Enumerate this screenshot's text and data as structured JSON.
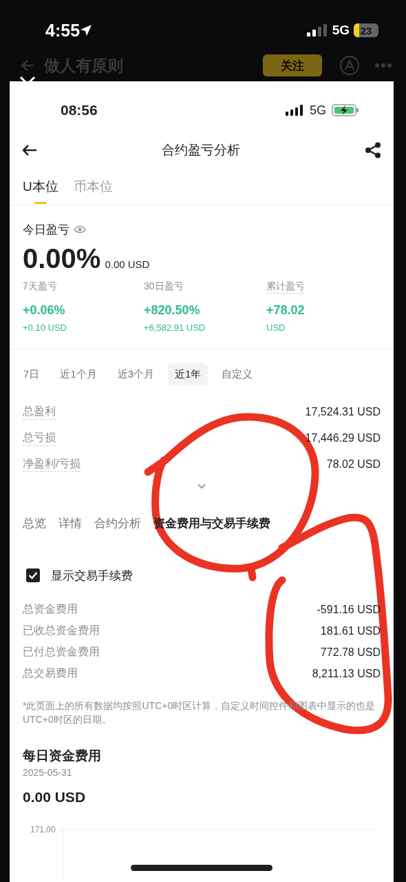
{
  "outer_status": {
    "time": "4:55",
    "network": "5G",
    "battery": "23"
  },
  "background_app": {
    "title": "做人有原则",
    "follow_button": "关注"
  },
  "status_bar": {
    "time": "08:56",
    "network": "5G"
  },
  "header": {
    "title": "合约盈亏分析"
  },
  "currency_tabs": [
    {
      "label": "U本位",
      "selected": true
    },
    {
      "label": "币本位",
      "selected": false
    }
  ],
  "today": {
    "label": "今日盈亏",
    "percent": "0.00%",
    "amount": "0.00 USD"
  },
  "stats": [
    {
      "label": "7天盈亏",
      "value": "+0.06%",
      "sub": "+0.10 USD"
    },
    {
      "label": "30日盈亏",
      "value": "+820.50%",
      "sub": "+6,582.91 USD"
    },
    {
      "label": "累计盈亏",
      "value": "+78.02",
      "sub": "USD"
    }
  ],
  "periods": [
    {
      "label": "7日",
      "selected": false
    },
    {
      "label": "近1个月",
      "selected": false
    },
    {
      "label": "近3个月",
      "selected": false
    },
    {
      "label": "近1年",
      "selected": true
    },
    {
      "label": "自定义",
      "selected": false
    }
  ],
  "summary_rows": [
    {
      "label": "总盈利",
      "value": "17,524.31 USD"
    },
    {
      "label": "总亏损",
      "value": "17,446.29 USD"
    },
    {
      "label": "净盈利/亏损",
      "value": "78.02 USD"
    }
  ],
  "section_tabs": [
    {
      "label": "总览",
      "selected": false
    },
    {
      "label": "详情",
      "selected": false
    },
    {
      "label": "合约分析",
      "selected": false
    },
    {
      "label": "资金费用与交易手续费",
      "selected": true
    }
  ],
  "show_fees": {
    "label": "显示交易手续费",
    "checked": true
  },
  "fee_rows": [
    {
      "label": "总资金费用",
      "value": "-591.16 USD"
    },
    {
      "label": "已收总资金费用",
      "value": "181.61 USD"
    },
    {
      "label": "已付总资金费用",
      "value": "772.78 USD"
    },
    {
      "label": "总交易费用",
      "value": "8,211.13 USD"
    }
  ],
  "footnote": "*此页面上的所有数据均按照UTC+0时区计算，自定义时间控件和图表中显示的也是UTC+0时区的日期。",
  "daily": {
    "title": "每日资金费用",
    "date": "2025-05-31",
    "amount": "0.00 USD",
    "chart": {
      "y_tick": "171.00"
    }
  },
  "markup": {
    "kind": "freehand"
  }
}
